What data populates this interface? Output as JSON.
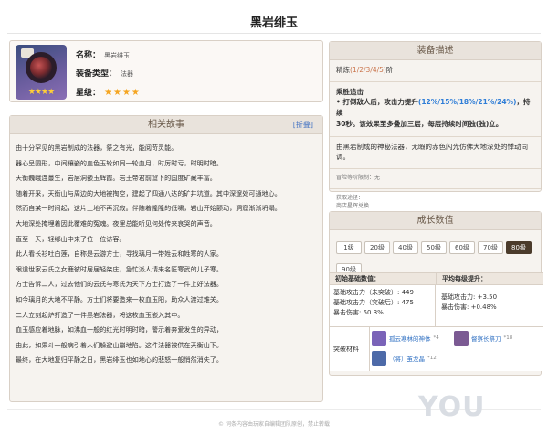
{
  "page": {
    "title": "黑岩绯玉"
  },
  "item": {
    "name_label": "名称：",
    "name_value": "黑岩绯玉",
    "type_label": "装备类型：",
    "type_value": "法器",
    "rarity_label": "星级：",
    "rarity_stars": "★★★★",
    "icon_stars": "★★★★"
  },
  "story": {
    "title": "相关故事",
    "fold_label": "[折叠]",
    "lines": [
      "由十分罕见的黑岩制成的法器，祭之有光，能阅苛灵能。",
      "器心呈圆形，中间镶嵌的血色玉轮如同一轮血月，时厉时亏，时明时暗。",
      "天衡巍峨连蔓生，岩层洞嵌玉辉霞。岩王帝君前窟下的国度矿藏丰富。",
      "随着开采，天衡山与周边的大地被掏空，建起了四通八达的矿井坑道。其中深邃处可通地心。",
      "然而自某一时间起，这片土地不再沉寂。伴随着隆隆的低啸，岩山开始颤动，洞窟渐渐坍塌。",
      "大地深处掩埋着因此覆难的冤魂。夜里总能听见何处传来哀哭的声音。",
      "直至一天，轻绑山中来了位一位访客。",
      "此人看长衫吐白莲，自称是云游方士，寻找璃月一带姓云和姓寒的人家。",
      "眼道世家云氏之女鹿彼时居居轻桀庄，急忙派人请来名匠寒武的儿子寒。",
      "方士告诉二人，过去他们的云氏与寒氏为天下方士打造了一件上好法器。",
      "如今璃月的大地不平静。方士们将要造来一枚血玉阳，助众人渡过难关。",
      "二人立刻起炉打造了一件黑岩法器，将这枚血玉嵌入其中。",
      "血玉感应着地脉，如沸血一般的红光时明时暗，警示着奔爱发生的异动，",
      "由此，如果斗一般病引着人们躲避山崩地陷。这件法器被供在天衡山下。",
      "最终，在大地复归平静之日，黑岩绯玉也如地心的悲怒一般悄然消失了。"
    ]
  },
  "equip": {
    "title": "装备描述",
    "refine_prefix": "精炼",
    "refine_levels": "(1/2/3/4/5)",
    "refine_suffix": "阶",
    "effect_name": "乘胜追击",
    "effect_line1_a": "• 打倒敌人后，攻击力提升",
    "effect_line1_pct": "(12%/15%/18%/21%/24%)",
    "effect_line1_b": "，持续",
    "effect_line2": "30秒。该效果至多叠加三层，每层持续时间独(独)立。",
    "desc_line1": "由黑岩制成的神秘法器，无暇的赤色闪光仿佛大地深处的悸动同",
    "desc_line2": "调。",
    "limit_text": "冒险等阶限制：无",
    "source_label": "获取途径：",
    "source_value": "商店星辉兑换"
  },
  "growth": {
    "title": "成长数值",
    "levels": [
      "1级",
      "20级",
      "40级",
      "50级",
      "60级",
      "70级",
      "80级",
      "90级"
    ],
    "active_level": "80级",
    "col_initial": "初始基础数值：",
    "col_avg": "平均每级提升：",
    "initial_lines": [
      "基础攻击力（未突破）: 449",
      "基础攻击力（突破后）: 475",
      "暴击伤害: 50.3%"
    ],
    "avg_lines": [
      "基础攻击力: +3.50",
      "暴击伤害: +0.48%"
    ],
    "materials_label": "突破材料",
    "materials": [
      {
        "name": "孤云寒林的神体",
        "count": "*4",
        "color": "#7a63b8"
      },
      {
        "name": "督察长祭刀",
        "count": "*18",
        "color": "#7b5a93"
      },
      {
        "name": "（将）茧龙晶",
        "count": "*12",
        "color": "#4d6aa8"
      }
    ]
  },
  "footer": {
    "text": "© 词条内容由玩家自编辑团队原创，禁止转载",
    "watermark": "YOU"
  },
  "colors": {
    "accent_gold": "#f5a623",
    "link_blue": "#2e6fc2",
    "pct_blue": "#2e7dd7",
    "active_level_bg": "#4b3b2b"
  }
}
